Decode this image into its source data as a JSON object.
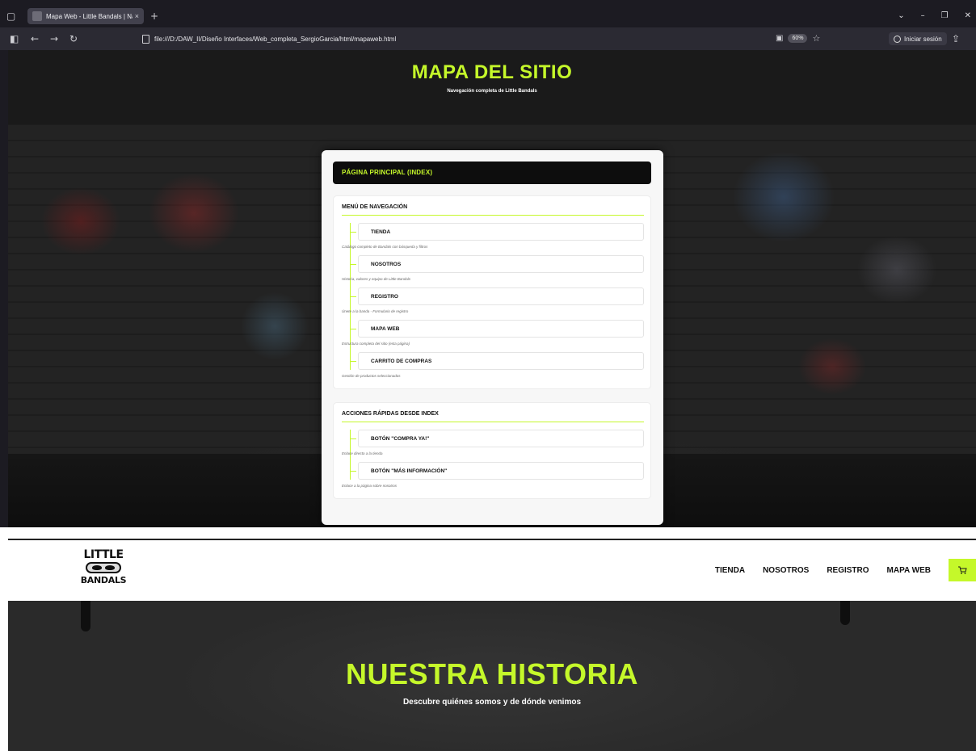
{
  "browser": {
    "tab_title": "Mapa Web - Little Bandals | Navega",
    "tab_close": "×",
    "new_tab": "+",
    "url": "file:///D:/DAW_II/Diseño Interfaces/Web_completa_SergioGarcia/html/mapaweb.html",
    "zoom": "60%",
    "signin_label": "Iniciar sesión",
    "back": "←",
    "forward": "→",
    "reload": "↻",
    "star": "☆",
    "list_tabs": "⌄",
    "minimize": "–",
    "maximize": "❐",
    "close": "✕"
  },
  "sitemap": {
    "title": "MAPA DEL SITIO",
    "subtitle": "Navegación completa de Little Bandals",
    "main_page": "PÁGINA PRINCIPAL (INDEX)",
    "nav_section": {
      "heading": "MENÚ DE NAVEGACIÓN",
      "items": [
        {
          "label": "TIENDA",
          "desc": "Catálogo completo de Bandals con búsqueda y filtros"
        },
        {
          "label": "NOSOTROS",
          "desc": "Historia, valores y equipo de Little Bandals"
        },
        {
          "label": "REGISTRO",
          "desc": "Únete a la banda - Formulario de registro"
        },
        {
          "label": "MAPA WEB",
          "desc": "Estructura completa del sitio (esta página)"
        },
        {
          "label": "CARRITO DE COMPRAS",
          "desc": "Gestión de productos seleccionados"
        }
      ]
    },
    "actions_section": {
      "heading": "ACCIONES RÁPIDAS DESDE INDEX",
      "items": [
        {
          "label": "BOTÓN \"COMPRA YA!\"",
          "desc": "Enlace directo a la tienda"
        },
        {
          "label": "BOTÓN \"MÁS INFORMACIÓN\"",
          "desc": "Enlace a la página sobre nosotros"
        }
      ]
    }
  },
  "site": {
    "logo_top": "LITTLE",
    "logo_bottom": "BANDALS",
    "nav": [
      "TIENDA",
      "NOSOTROS",
      "REGISTRO",
      "MAPA WEB"
    ],
    "cart_icon": "cart-icon",
    "hero_title": "NUESTRA HISTORIA",
    "hero_subtitle": "Descubre quiénes somos y de dónde venimos"
  },
  "colors": {
    "accent": "#c5f82a",
    "dark": "#0d0d0d"
  }
}
